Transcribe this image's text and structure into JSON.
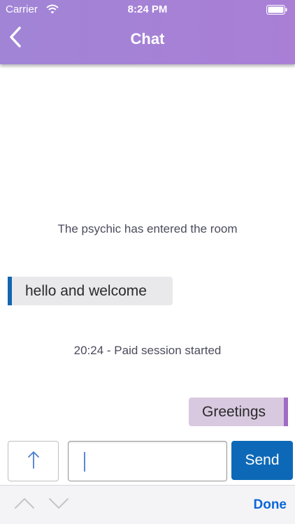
{
  "status_bar": {
    "carrier": "Carrier",
    "time": "8:24 PM",
    "icons": [
      "wifi-icon",
      "battery-icon"
    ]
  },
  "header": {
    "title": "Chat",
    "back_icon": "chevron-left-icon",
    "color": "#a583d6"
  },
  "messages": [
    {
      "type": "system",
      "text": "The psychic has entered the room"
    },
    {
      "type": "incoming",
      "text": "hello and welcome",
      "accent": "#1466b0"
    },
    {
      "type": "system",
      "text": "20:24 - Paid session started"
    },
    {
      "type": "outgoing",
      "text": "Greetings",
      "accent": "#9f6bc3"
    }
  ],
  "composer": {
    "upload_icon": "arrow-up-icon",
    "input_value": "",
    "send_label": "Send",
    "send_color": "#0d69b8"
  },
  "keyboard_toolbar": {
    "prev_icon": "chevron-up-icon",
    "next_icon": "chevron-down-icon",
    "done_label": "Done"
  }
}
